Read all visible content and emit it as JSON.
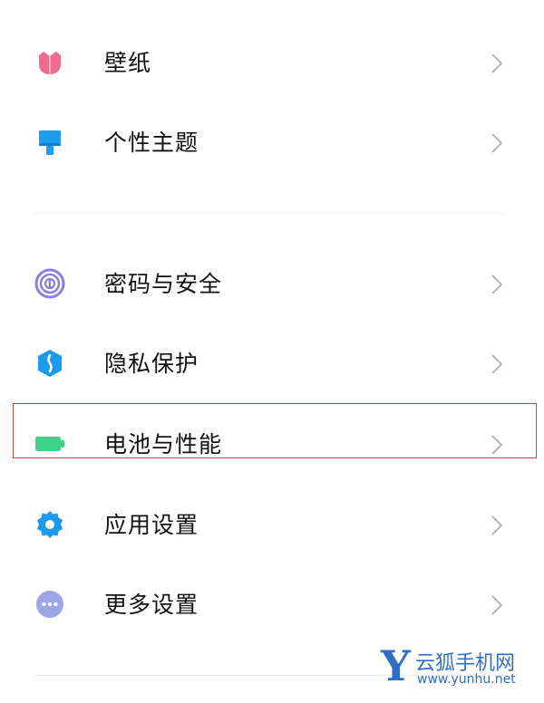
{
  "settings": {
    "group1": [
      {
        "label": "壁纸",
        "icon": "tulip-wallpaper-icon",
        "color": "#f06b8e"
      },
      {
        "label": "个性主题",
        "icon": "paintbrush-theme-icon",
        "color": "#1e9cf0"
      }
    ],
    "group2": [
      {
        "label": "密码与安全",
        "icon": "fingerprint-icon",
        "color": "#8b7fe0"
      },
      {
        "label": "隐私保护",
        "icon": "privacy-shield-icon",
        "color": "#1a9bf0"
      },
      {
        "label": "电池与性能",
        "icon": "battery-icon",
        "color": "#3ed389"
      },
      {
        "label": "应用设置",
        "icon": "gear-icon",
        "color": "#1a9bf0"
      },
      {
        "label": "更多设置",
        "icon": "more-dots-icon",
        "color": "#9aa6e8"
      }
    ]
  },
  "watermark": {
    "letter": "Y",
    "name": "云狐手机网",
    "url": "www.yunhu.net"
  },
  "colors": {
    "highlight": "#c8463c",
    "chevron": "#b5b5b5",
    "watermark": "#2f6fc6"
  }
}
